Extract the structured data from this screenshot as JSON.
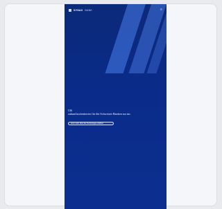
{
  "brand": {
    "name_bold": "SYNAX",
    "name_light": "BANK"
  },
  "hero": {
    "kicker": "Ulli",
    "headline": "zukunftsorientiertes für die Schweizer Banken sur.inc.",
    "cta": "Jetzt mehr über die Technologie erfahren"
  },
  "menu_icon": "menu-icon",
  "colors": {
    "hero_bg": "#0b2a7a",
    "stripe": "#4b7deb"
  }
}
